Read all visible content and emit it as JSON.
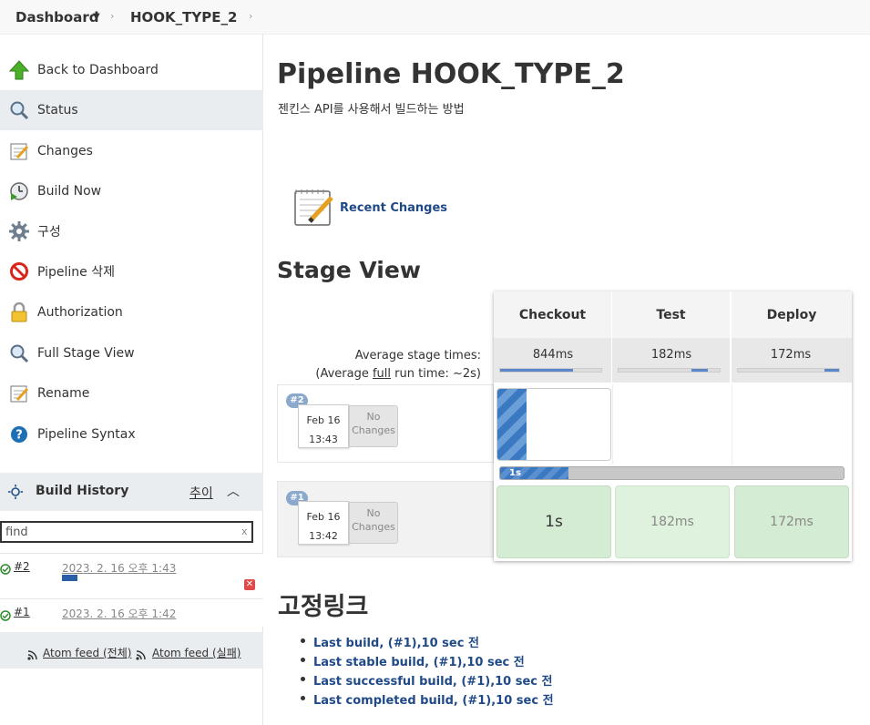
{
  "breadcrumb": {
    "dashboard": "Dashboard",
    "job": "HOOK_TYPE_2"
  },
  "sidebar": {
    "items": [
      {
        "label": "Back to Dashboard",
        "icon": "up-arrow-icon"
      },
      {
        "label": "Status",
        "icon": "search-icon"
      },
      {
        "label": "Changes",
        "icon": "notepad-icon"
      },
      {
        "label": "Build Now",
        "icon": "clock-play-icon"
      },
      {
        "label": "구성",
        "icon": "gear-icon"
      },
      {
        "label": "Pipeline 삭제",
        "icon": "no-entry-icon"
      },
      {
        "label": "Authorization",
        "icon": "lock-icon"
      },
      {
        "label": "Full Stage View",
        "icon": "search-icon"
      },
      {
        "label": "Rename",
        "icon": "notepad-icon"
      },
      {
        "label": "Pipeline Syntax",
        "icon": "help-icon"
      }
    ]
  },
  "build_history": {
    "title": "Build History",
    "trend": "추이",
    "find_value": "find",
    "find_clear": "x",
    "builds": [
      {
        "number": "#2",
        "date": "2023. 2. 16 오후 1:43",
        "progress": 0.17
      },
      {
        "number": "#1",
        "date": "2023. 2. 16 오후 1:42"
      }
    ],
    "feed_all": "Atom feed (전체)",
    "feed_fail": "Atom feed (실패)"
  },
  "main": {
    "title": "Pipeline HOOK_TYPE_2",
    "description": "젠킨스 API를 사용해서 빌드하는 방법",
    "recent_changes": "Recent Changes",
    "stage_view_title": "Stage View",
    "avg_stage_times": "Average stage times:",
    "avg_full_prefix": "(Average ",
    "avg_full_link": "full",
    "avg_full_suffix": " run time: ~2s)",
    "stages": [
      {
        "name": "Checkout",
        "avg": "844ms",
        "fill_start": 0.0,
        "fill_end": 0.72
      },
      {
        "name": "Test",
        "avg": "182ms",
        "fill_start": 0.72,
        "fill_end": 0.88
      },
      {
        "name": "Deploy",
        "avg": "172ms",
        "fill_start": 0.86,
        "fill_end": 1.0
      }
    ],
    "runs": [
      {
        "badge": "#2",
        "date_line1": "Feb 16",
        "date_line2": "13:43",
        "no_changes": "No Changes",
        "progress_label": "1s",
        "progress": 0.2
      },
      {
        "badge": "#1",
        "date_line1": "Feb 16",
        "date_line2": "13:42",
        "no_changes": "No Changes",
        "cells": [
          "1s",
          "182ms",
          "172ms"
        ]
      }
    ],
    "permalinks_title": "고정링크",
    "permalinks": [
      "Last build, (#1),10 sec 전",
      "Last stable build, (#1),10 sec 전",
      "Last successful build, (#1),10 sec 전",
      "Last completed build, (#1),10 sec 전"
    ]
  },
  "colors": {
    "link": "#204a87",
    "success_cell": "#d4ecd3",
    "success_cell_light": "#dff2dd",
    "progress_blue": "#4a86c8",
    "sidebar_active": "#e9edf0"
  }
}
